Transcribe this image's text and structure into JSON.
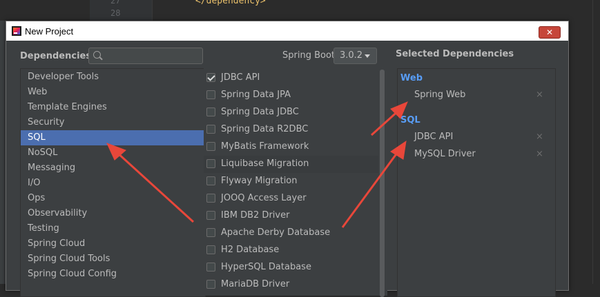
{
  "editor": {
    "line_numbers": [
      "27",
      "28"
    ],
    "code_line": "</dependency>"
  },
  "dialog": {
    "title": "New Project",
    "close_label": "✕"
  },
  "dependencies_label": "Dependencies",
  "search": {
    "placeholder": "",
    "value": ""
  },
  "spring_boot": {
    "label": "Spring Boot",
    "version": "3.0.2"
  },
  "categories": [
    {
      "label": "Developer Tools",
      "selected": false
    },
    {
      "label": "Web",
      "selected": false
    },
    {
      "label": "Template Engines",
      "selected": false
    },
    {
      "label": "Security",
      "selected": false
    },
    {
      "label": "SQL",
      "selected": true
    },
    {
      "label": "NoSQL",
      "selected": false
    },
    {
      "label": "Messaging",
      "selected": false
    },
    {
      "label": "I/O",
      "selected": false
    },
    {
      "label": "Ops",
      "selected": false
    },
    {
      "label": "Observability",
      "selected": false
    },
    {
      "label": "Testing",
      "selected": false
    },
    {
      "label": "Spring Cloud",
      "selected": false
    },
    {
      "label": "Spring Cloud Tools",
      "selected": false
    },
    {
      "label": "Spring Cloud Config",
      "selected": false
    }
  ],
  "dependencies": [
    {
      "label": "JDBC API",
      "checked": true
    },
    {
      "label": "Spring Data JPA",
      "checked": false
    },
    {
      "label": "Spring Data JDBC",
      "checked": false
    },
    {
      "label": "Spring Data R2DBC",
      "checked": false
    },
    {
      "label": "MyBatis Framework",
      "checked": false
    },
    {
      "label": "Liquibase Migration",
      "checked": false
    },
    {
      "label": "Flyway Migration",
      "checked": false
    },
    {
      "label": "JOOQ Access Layer",
      "checked": false
    },
    {
      "label": "IBM DB2 Driver",
      "checked": false
    },
    {
      "label": "Apache Derby Database",
      "checked": false
    },
    {
      "label": "H2 Database",
      "checked": false
    },
    {
      "label": "HyperSQL Database",
      "checked": false
    },
    {
      "label": "MariaDB Driver",
      "checked": false
    }
  ],
  "selected": {
    "heading": "Selected Dependencies",
    "groups": [
      {
        "name": "Web",
        "items": [
          "Spring Web"
        ]
      },
      {
        "name": "SQL",
        "items": [
          "JDBC API",
          "MySQL Driver"
        ]
      }
    ],
    "remove_glyph": "×"
  },
  "colors": {
    "accent": "#4b6eaf",
    "group_heading": "#589df6",
    "annotation_arrow": "#e8473a"
  }
}
